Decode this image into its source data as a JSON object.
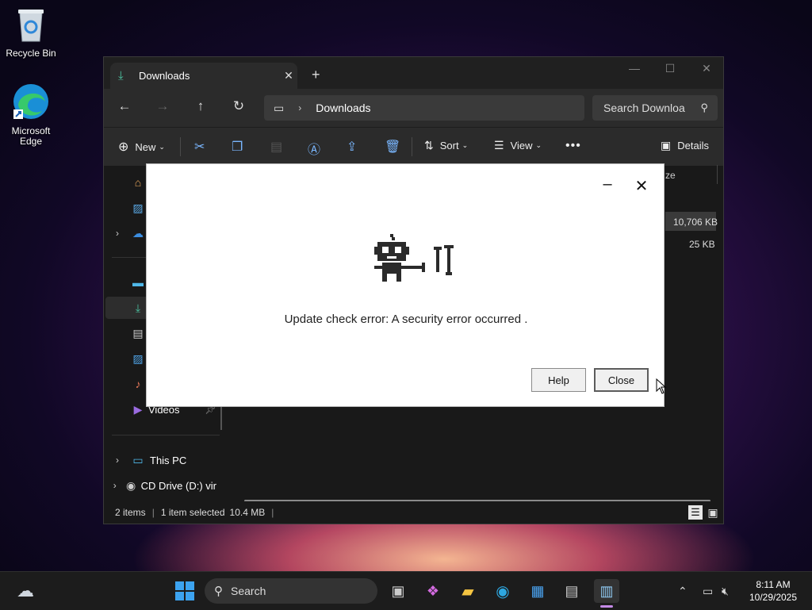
{
  "desktop": {
    "icons": [
      {
        "label": "Recycle Bin",
        "icon": "recycle-bin-icon"
      },
      {
        "label": "Microsoft Edge",
        "icon": "edge-icon"
      }
    ]
  },
  "explorer": {
    "tab_title": "Downloads",
    "address_path": "Downloads",
    "search_placeholder": "Search Downloa",
    "toolbar": {
      "new_label": "New",
      "sort_label": "Sort",
      "view_label": "View",
      "details_label": "Details"
    },
    "sidebar": {
      "videos_label": "Videos",
      "this_pc_label": "This PC",
      "cd_drive_label": "CD Drive (D:) vir"
    },
    "content": {
      "size_header_partial": "ze",
      "sizes": [
        "10,706 KB",
        "25 KB"
      ]
    },
    "status": {
      "items": "2 items",
      "selection": "1 item selected",
      "size": "10.4 MB"
    }
  },
  "dialog": {
    "message": "Update check error: A security error occurred .",
    "help_label": "Help",
    "close_label": "Close"
  },
  "taskbar": {
    "search_label": "Search",
    "time": "8:11 AM",
    "date": "10/29/2025"
  },
  "colors": {
    "accent_green": "#4cc2a0",
    "explorer_bg": "#191919",
    "dialog_bg": "#ffffff"
  }
}
